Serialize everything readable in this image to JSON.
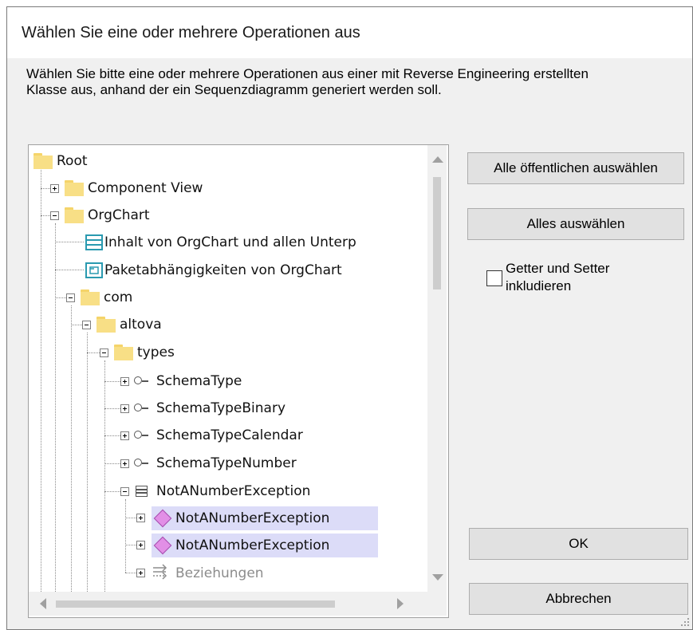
{
  "window": {
    "title": "Wählen Sie eine oder mehrere Operationen aus"
  },
  "instructions": "Wählen Sie bitte eine oder mehrere Operationen aus einer mit Reverse Engineering erstellten Klasse aus, anhand der ein Sequenzdiagramm generiert werden soll.",
  "tree": {
    "items": [
      {
        "label": "Root",
        "icon": "folder-icon"
      },
      {
        "label": "Component View",
        "icon": "folder-icon",
        "expanded": false
      },
      {
        "label": "OrgChart",
        "icon": "folder-icon",
        "expanded": true
      },
      {
        "label": "Inhalt von OrgChart und allen Unterp",
        "icon": "content-diagram-icon"
      },
      {
        "label": "Paketabhängigkeiten von OrgChart",
        "icon": "package-diagram-icon"
      },
      {
        "label": "com",
        "icon": "folder-icon",
        "expanded": true
      },
      {
        "label": "altova",
        "icon": "folder-icon",
        "expanded": true
      },
      {
        "label": "types",
        "icon": "folder-icon",
        "expanded": true
      },
      {
        "label": "SchemaType",
        "icon": "interface-icon",
        "expanded": false
      },
      {
        "label": "SchemaTypeBinary",
        "icon": "interface-icon",
        "expanded": false
      },
      {
        "label": "SchemaTypeCalendar",
        "icon": "interface-icon",
        "expanded": false
      },
      {
        "label": "SchemaTypeNumber",
        "icon": "interface-icon",
        "expanded": false
      },
      {
        "label": "NotANumberException",
        "icon": "class-icon",
        "expanded": true
      },
      {
        "label": "NotANumberException",
        "icon": "operation-icon",
        "expanded": false,
        "selected": true
      },
      {
        "label": "NotANumberException",
        "icon": "operation-icon",
        "expanded": false,
        "selected": true
      },
      {
        "label": "Beziehungen",
        "icon": "relations-icon",
        "expanded": false,
        "disabled": true
      }
    ]
  },
  "buttons": {
    "select_public": "Alle öffentlichen auswählen",
    "select_all": "Alles auswählen",
    "ok": "OK",
    "cancel": "Abbrechen"
  },
  "checkbox": {
    "label": "Getter und Setter inkludieren",
    "checked": false
  },
  "colors": {
    "selection": "#dcdcf8",
    "folder": "#f8df86",
    "operation": "#e28fe6",
    "diagram": "#2a9ab0"
  }
}
